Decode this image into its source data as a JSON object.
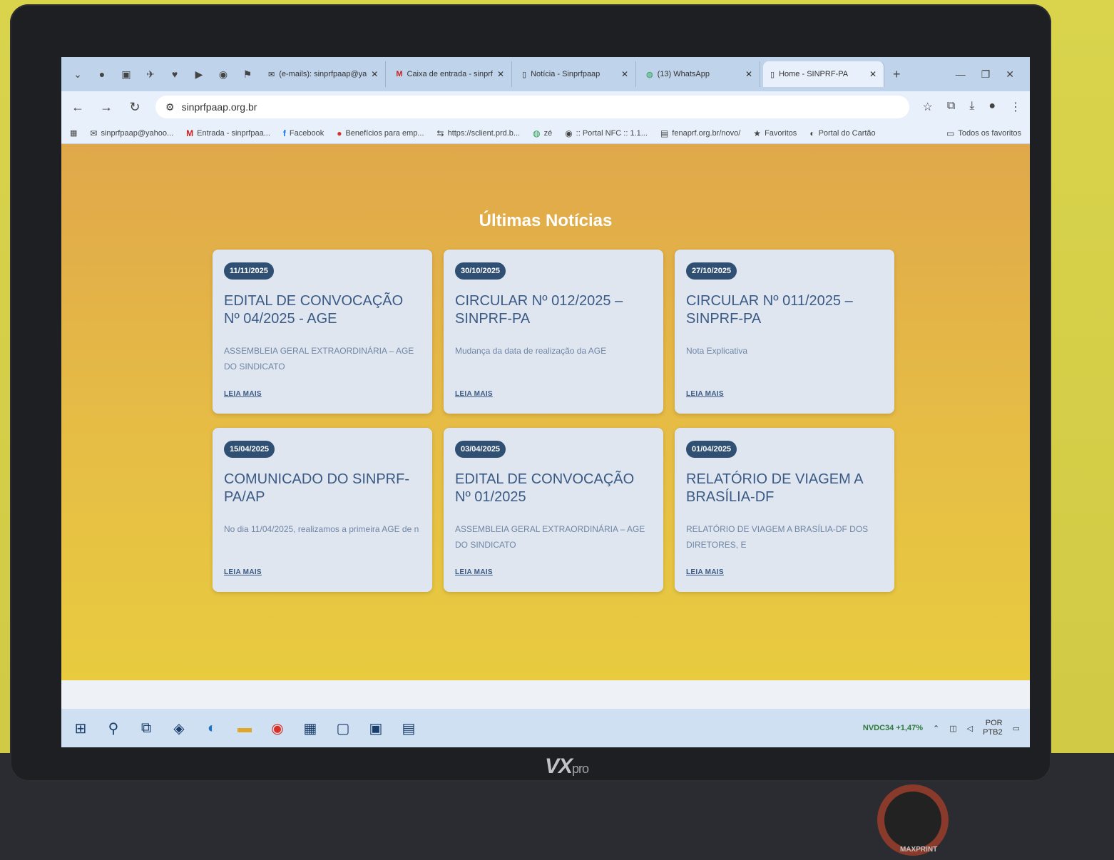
{
  "browser": {
    "tabs": [
      {
        "label": "(e-mails): sinprfpaap@ya",
        "icon": "mail-icon",
        "active": false
      },
      {
        "label": "Caixa de entrada - sinprf",
        "icon": "gmail-icon",
        "active": false
      },
      {
        "label": "Notícia - Sinprfpaap",
        "icon": "page-icon",
        "active": false
      },
      {
        "label": "(13) WhatsApp",
        "icon": "whatsapp-icon",
        "active": false
      },
      {
        "label": "Home - SINPRF-PA",
        "icon": "page-icon",
        "active": true
      }
    ],
    "address": "sinprfpaap.org.br",
    "bookmarks": [
      {
        "label": "sinprfpaap@yahoo...",
        "icon": "mail-icon"
      },
      {
        "label": "Entrada - sinprfpaa...",
        "icon": "gmail-icon"
      },
      {
        "label": "Facebook",
        "icon": "facebook-icon"
      },
      {
        "label": "Benefícios para emp...",
        "icon": "bookmark-icon"
      },
      {
        "label": "https://sclient.prd.b...",
        "icon": "bookmark-icon"
      },
      {
        "label": "zé",
        "icon": "whatsapp-icon"
      },
      {
        "label": ":: Portal NFC :: 1.1...",
        "icon": "bookmark-icon"
      },
      {
        "label": "fenaprf.org.br/novo/",
        "icon": "bookmark-icon"
      },
      {
        "label": "Favoritos",
        "icon": "star-icon"
      },
      {
        "label": "Portal do Cartão",
        "icon": "bookmark-icon"
      }
    ],
    "all_bookmarks": "Todos os favoritos"
  },
  "page": {
    "section_title": "Últimas Notícias",
    "read_more": "LEIA MAIS",
    "news": [
      {
        "date": "11/11/2025",
        "title": "EDITAL DE CONVOCAÇÃO Nº 04/2025 - AGE",
        "excerpt": "ASSEMBLEIA GERAL EXTRAORDINÁRIA – AGE DO SINDICATO"
      },
      {
        "date": "30/10/2025",
        "title": "CIRCULAR Nº 012/2025 – SINPRF-PA",
        "excerpt": "Mudança da data de realização da AGE"
      },
      {
        "date": "27/10/2025",
        "title": "CIRCULAR Nº 011/2025 – SINPRF-PA",
        "excerpt": "Nota Explicativa"
      },
      {
        "date": "15/04/2025",
        "title": "COMUNICADO DO SINPRF-PA/AP",
        "excerpt": "No dia 11/04/2025, realizamos a primeira AGE de n"
      },
      {
        "date": "03/04/2025",
        "title": "EDITAL DE CONVOCAÇÃO Nº 01/2025",
        "excerpt": "ASSEMBLEIA GERAL EXTRAORDINÁRIA – AGE DO SINDICATO"
      },
      {
        "date": "01/04/2025",
        "title": "RELATÓRIO DE VIAGEM A BRASÍLIA-DF",
        "excerpt": "RELATÓRIO DE VIAGEM A BRASÍLIA-DF DOS DIRETORES, E"
      }
    ]
  },
  "taskbar": {
    "stock": "NVDC34",
    "stock_change": "+1,47%",
    "lang": "POR",
    "lang2": "PTB2"
  },
  "monitor": {
    "brand": "VX",
    "brand_suffix": "pro",
    "speaker_brand": "MAXPRINT"
  },
  "colors": {
    "page_bg": "#e3b64a",
    "card_bg": "#dfe6ef",
    "badge_bg": "#2f4f73",
    "title_color": "#3a5a85"
  }
}
